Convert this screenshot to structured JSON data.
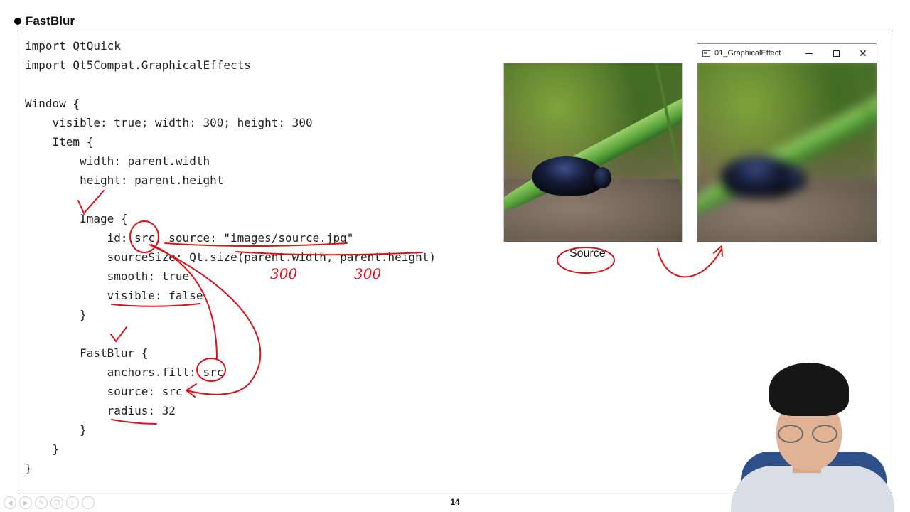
{
  "slide": {
    "title": "FastBlur",
    "page_number": "14"
  },
  "code_lines": [
    "import QtQuick",
    "import Qt5Compat.GraphicalEffects",
    "",
    "Window {",
    "    visible: true; width: 300; height: 300",
    "    Item {",
    "        width: parent.width",
    "        height: parent.height",
    "",
    "        Image {",
    "            id: src; source: \"images/source.jpg\"",
    "            sourceSize: Qt.size(parent.width, parent.height)",
    "            smooth: true",
    "            visible: false",
    "        }",
    "",
    "        FastBlur {",
    "            anchors.fill: src",
    "            source: src",
    "            radius: 32",
    "        }",
    "    }",
    "}"
  ],
  "source_label": "Source",
  "blur_window": {
    "title": "01_GraphicalEffect",
    "minimize_icon": "minimize-icon",
    "maximize_icon": "maximize-icon",
    "close_icon": "close-icon",
    "close_glyph": "✕"
  },
  "handwritten_notes": [
    "300",
    "300"
  ],
  "annotation_color": "#d8141b",
  "toolbar_icons": [
    "prev-icon",
    "next-icon",
    "pen-icon",
    "copy-icon",
    "zoom-icon",
    "more-icon"
  ],
  "toolbar_glyphs": [
    "◀",
    "▶",
    "✎",
    "❐",
    "⌕",
    "⋯"
  ]
}
